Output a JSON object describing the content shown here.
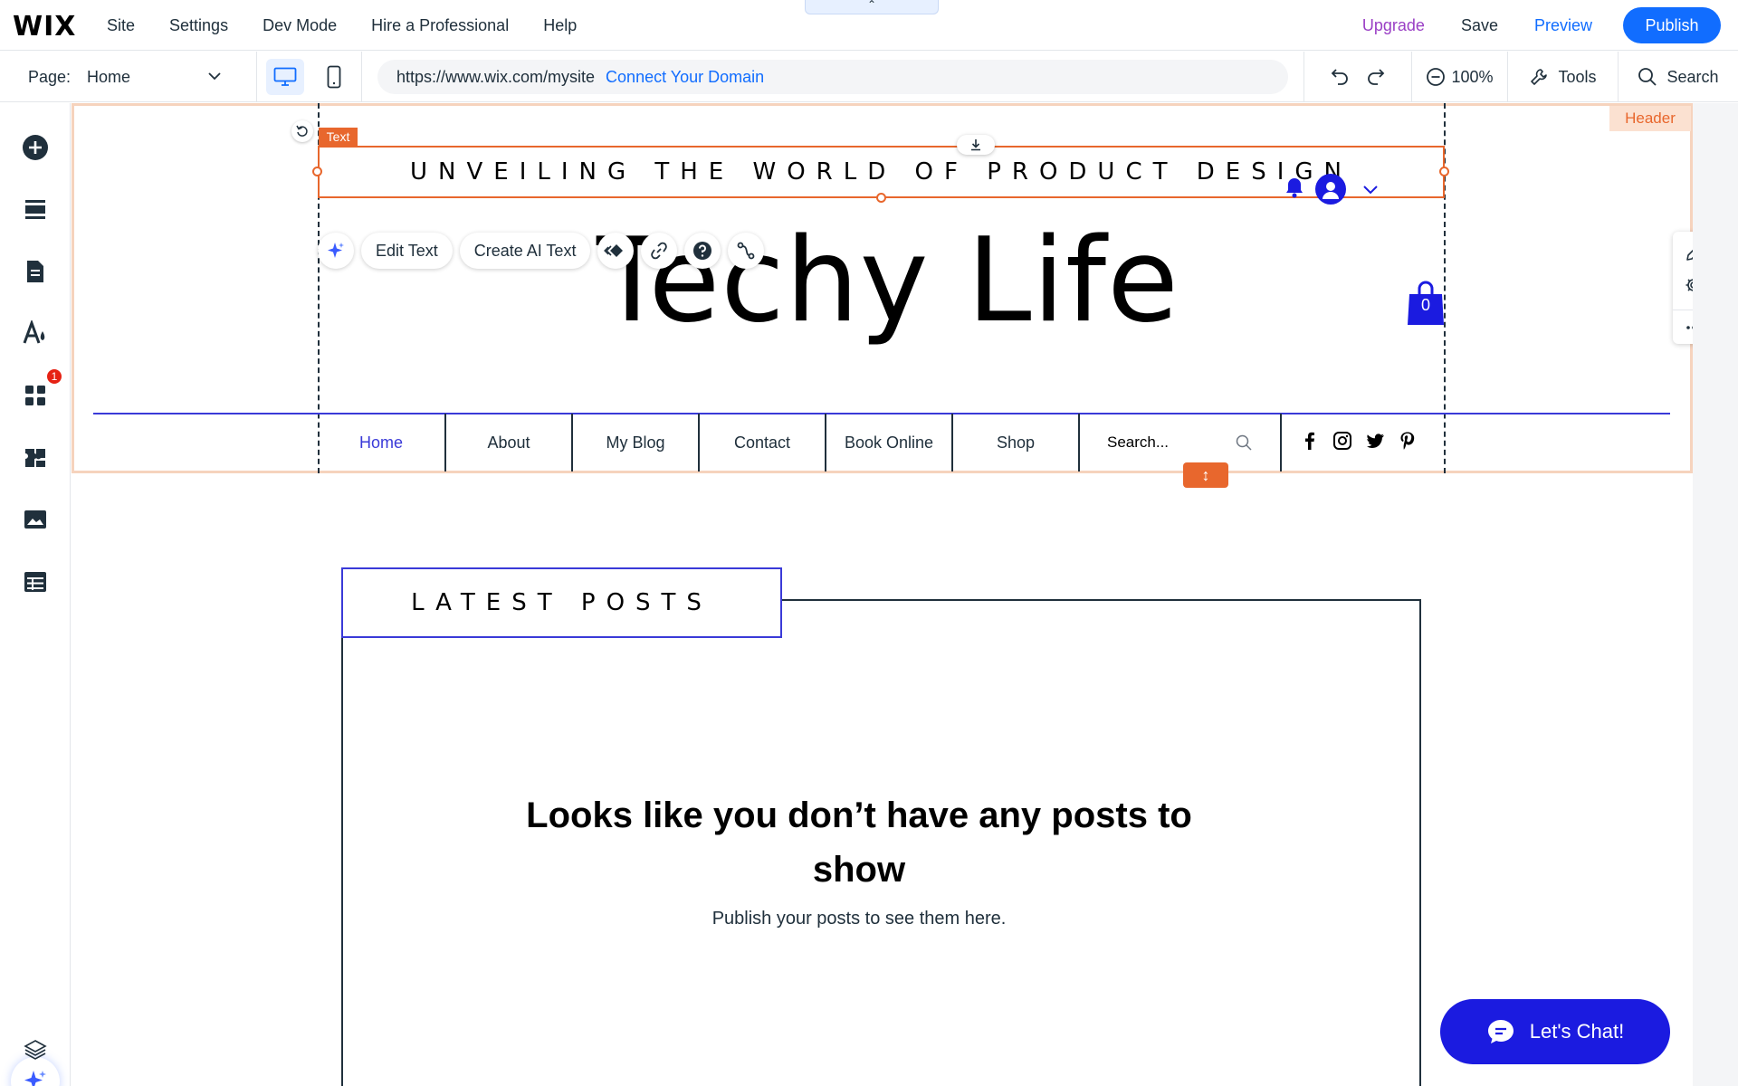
{
  "topbar": {
    "logo": "WIX",
    "menu": [
      "Site",
      "Settings",
      "Dev Mode",
      "Hire a Professional",
      "Help"
    ],
    "upgrade": "Upgrade",
    "save": "Save",
    "preview": "Preview",
    "publish": "Publish",
    "collapse_glyph": "⌃"
  },
  "bar2": {
    "page_label": "Page:",
    "page_value": "Home",
    "url": "https://www.wix.com/mysite",
    "connect": "Connect Your Domain",
    "zoom": "100%",
    "tools": "Tools",
    "search": "Search"
  },
  "leftrail": {
    "icons": [
      "add-elements-icon",
      "sections-icon",
      "pages-icon",
      "design-icon",
      "apps-icon",
      "business-icon",
      "media-icon",
      "cms-icon"
    ],
    "apps_badge": "1"
  },
  "canvas": {
    "header_tag": "Header",
    "text_tag": "Text",
    "tagline": "UNVEILING THE WORLD OF PRODUCT DESIGN",
    "site_title": "Techy Life",
    "edit_text": "Edit Text",
    "create_ai_text": "Create AI Text",
    "cart_count": "0",
    "nav": [
      "Home",
      "About",
      "My Blog",
      "Contact",
      "Book Online",
      "Shop"
    ],
    "nav_search_placeholder": "Search...",
    "resize_glyph": "↕",
    "latest_posts": "LATEST POSTS",
    "empty_title": "Looks like you don’t have any posts to show",
    "empty_sub": "Publish your posts to see them here.",
    "chat": "Let's Chat!"
  },
  "colors": {
    "accent": "#116dff",
    "selection": "#e8672d",
    "brand_blue": "#1b1be0",
    "upgrade": "#9a3fc5"
  }
}
